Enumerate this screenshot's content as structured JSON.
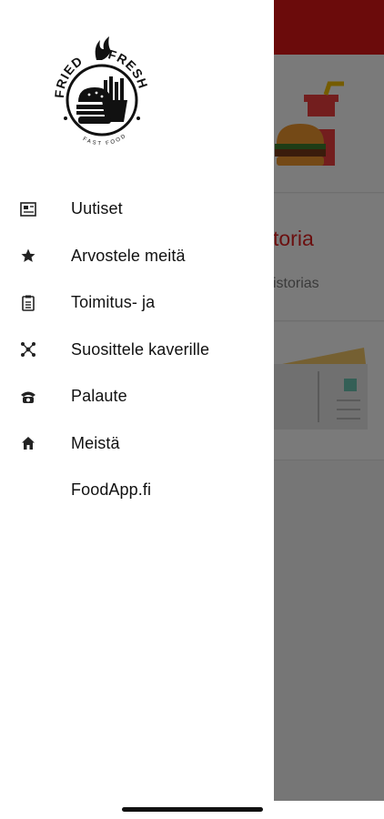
{
  "background": {
    "header_color": "#e01818",
    "card2": {
      "title_fragment": "toria",
      "subtitle_fragment": "istorias"
    }
  },
  "drawer": {
    "logo": {
      "brand_left": "FRIED",
      "brand_right": "FRESH",
      "tagline": "FAST FOOD"
    },
    "items": [
      {
        "label": "Uutiset",
        "icon": "newspaper-icon"
      },
      {
        "label": "Arvostele meitä",
        "icon": "star-icon"
      },
      {
        "label": "Toimitus- ja",
        "icon": "clipboard-icon"
      },
      {
        "label": "Suosittele kaverille",
        "icon": "share-icon"
      },
      {
        "label": "Palaute",
        "icon": "phone-icon"
      },
      {
        "label": "Meistä",
        "icon": "home-icon"
      },
      {
        "label": "FoodApp.fi",
        "icon": ""
      }
    ]
  },
  "colors": {
    "accent": "#e01818",
    "scrim": "rgba(0,0,0,0.52)",
    "drawer_bg": "#ffffff"
  }
}
